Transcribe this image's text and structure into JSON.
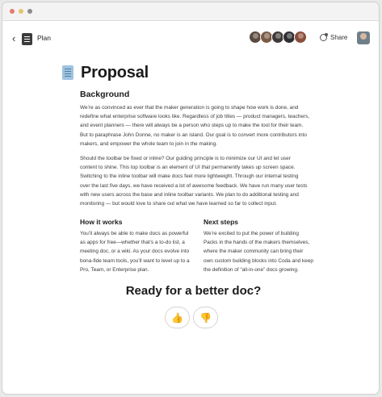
{
  "window": {
    "controls": [
      "close",
      "minimize",
      "zoom"
    ]
  },
  "topbar": {
    "back_icon": "chevron-left-icon",
    "breadcrumb": "Plan",
    "share_label": "Share",
    "share_icon": "share-icon",
    "avatar_colors": [
      "#5b4a3f",
      "#7a5b45",
      "#3f3a36",
      "#2e2e33",
      "#8a4e3b"
    ]
  },
  "doc": {
    "icon": "document-icon",
    "title": "Proposal",
    "background_heading": "Background",
    "background_p1": [
      "We’re as convinced as ever that the maker generation is going to shape how work is done, and",
      "redefine what enterprise software looks like. Regardless of job titles — product managers, teachers,",
      "and event planners — there will always be a person who steps up to make the tool for their team.",
      "But to paraphrase John Donne, no maker is an island. Our goal is to convert more contributors into",
      "makers, and empower the whole team to join in the making."
    ],
    "background_p2": [
      "Should the toolbar be fixed or inline? Our guiding principle is to minimize our UI and let user",
      "content to shine. This top toolbar is an element of UI that permanently takes up screen space.",
      "Switching to the inline toolbar will make docs feel more lightweight. Through our internal testing",
      "over the last five days, we have received a lot of awesome feedback. We have run many user tests",
      "with new users across the base and inline toolbar variants. We plan to do additional testing and",
      "monitoring — but would love to share out what we have learned so far to collect input."
    ],
    "how_heading": "How it works",
    "how_text": [
      "You’ll always be able to make docs as powerful",
      "as apps for free—whether that’s a to-do list, a",
      "meeting doc, or a wiki. As your docs evolve into",
      "bona-fide team tools, you’ll want to level up to a",
      "Pro, Team, or Enterprise plan."
    ],
    "next_heading": "Next steps",
    "next_text": [
      "We’re excited to put the power of building",
      "Packs in the hands of the makers themselves,",
      "where the maker community can bring their",
      "own custom building blocks into Coda and keep",
      "the definition of “all-in-one” docs growing."
    ],
    "cta": "Ready for a better doc?",
    "reactions": [
      {
        "icon": "thumbs-up-icon",
        "glyph": "👍"
      },
      {
        "icon": "thumbs-down-icon",
        "glyph": "👎"
      }
    ]
  }
}
